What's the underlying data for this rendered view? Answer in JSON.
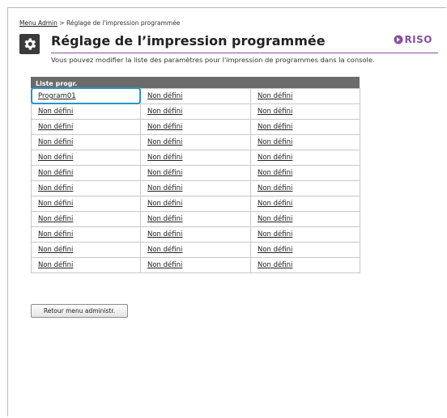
{
  "breadcrumb": {
    "link": "Menu Admin",
    "separator": ">",
    "current": "Réglage de l'impression programmée"
  },
  "header": {
    "title": "Réglage de l’impression programmée",
    "logo_text": "RISO",
    "description": "Vous pouvez modifier la liste des paramètres pour l'impression de programmes dans la console."
  },
  "table": {
    "header": "Liste progr.",
    "rows": [
      [
        "Program01",
        "Non défini",
        "Non défini"
      ],
      [
        "Non défini",
        "Non défini",
        "Non défini"
      ],
      [
        "Non défini",
        "Non défini",
        "Non défini"
      ],
      [
        "Non défini",
        "Non défini",
        "Non défini"
      ],
      [
        "Non défini",
        "Non défini",
        "Non défini"
      ],
      [
        "Non défini",
        "Non défini",
        "Non défini"
      ],
      [
        "Non défini",
        "Non défini",
        "Non défini"
      ],
      [
        "Non défini",
        "Non défini",
        "Non défini"
      ],
      [
        "Non défini",
        "Non défini",
        "Non défini"
      ],
      [
        "Non défini",
        "Non défini",
        "Non défini"
      ],
      [
        "Non défini",
        "Non défini",
        "Non défini"
      ],
      [
        "Non défini",
        "Non défini",
        "Non défini"
      ]
    ]
  },
  "buttons": {
    "back": "Retour menu administr."
  },
  "colors": {
    "accent": "#8a4fa0",
    "selection": "#2a93c4",
    "table_header": "#6b6b6b"
  },
  "icons": {
    "settings": "gear-icon",
    "logo": "riso-logo-icon"
  }
}
